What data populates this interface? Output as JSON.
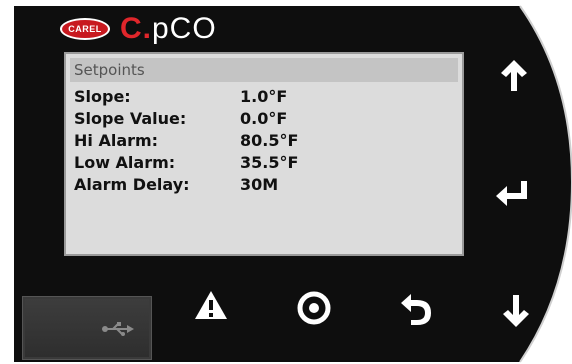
{
  "device": {
    "brand_badge": "CAREL",
    "brand_prefix": "C.",
    "brand_suffix": "pCO"
  },
  "screen": {
    "title": "Setpoints",
    "rows": [
      {
        "label": "Slope:",
        "value": "1.0°F"
      },
      {
        "label": "Slope Value:",
        "value": "0.0°F"
      },
      {
        "label": "Hi Alarm:",
        "value": "80.5°F"
      },
      {
        "label": "Low Alarm:",
        "value": "35.5°F"
      },
      {
        "label": "Alarm Delay:",
        "value": "30M"
      }
    ]
  },
  "keys": {
    "up": "arrow-up-icon",
    "enter": "enter-icon",
    "down": "arrow-down-icon",
    "alarm": "alarm-warning-icon",
    "program": "program-ring-icon",
    "escape": "escape-return-icon",
    "usb": "usb-icon"
  },
  "colors": {
    "bezel": "#0e0e0e",
    "brand_red": "#e0262b",
    "screen_bg": "#dcdcdc",
    "title_bar": "#c4c4c4"
  }
}
